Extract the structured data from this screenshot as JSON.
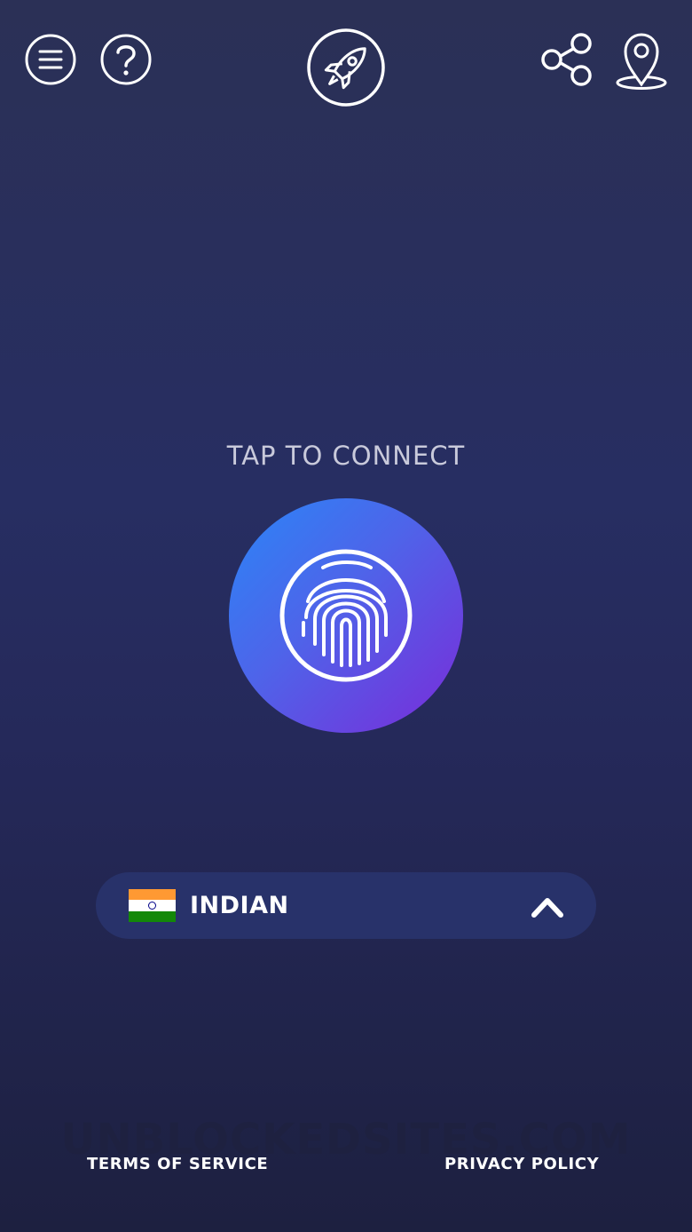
{
  "header": {
    "icons": {
      "menu": "menu-icon",
      "help": "question-icon",
      "boost": "rocket-icon",
      "share": "share-icon",
      "location": "location-pin-icon"
    }
  },
  "main": {
    "connect_label": "TAP TO CONNECT",
    "connect_icon": "fingerprint-icon",
    "accent_gradient": [
      "#2a86f7",
      "#4f63e9",
      "#7a2bd9"
    ]
  },
  "server": {
    "country": "INDIAN",
    "flag": "india-flag",
    "toggle_icon": "chevron-up-icon"
  },
  "footer": {
    "terms_label": "TERMS OF SERVICE",
    "privacy_label": "PRIVACY POLICY",
    "watermark": "UNBLOCKEDSITES.COM"
  },
  "colors": {
    "background_top": "#2b3056",
    "background_bottom": "#1d2040",
    "pill_background": "#28326a",
    "label_color": "#c9cadb"
  }
}
